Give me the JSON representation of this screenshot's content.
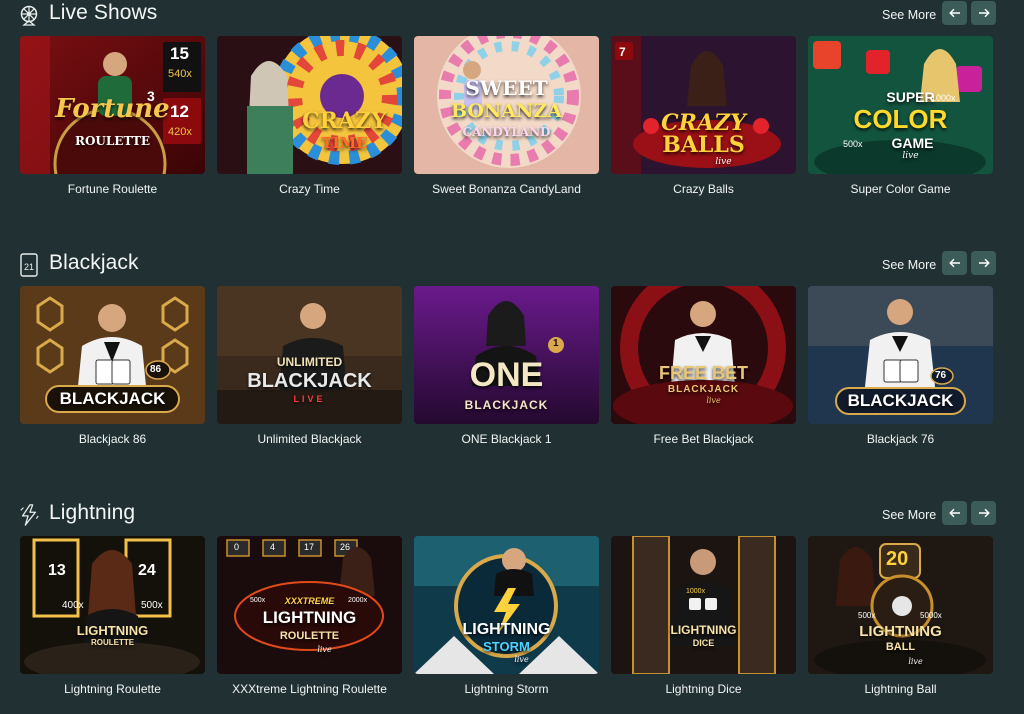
{
  "sections": [
    {
      "title": "Live Shows",
      "icon": "wheel-icon",
      "see_more": "See More",
      "cards": [
        {
          "name": "Fortune Roulette",
          "logo": [
            "Fortune",
            "ROULETTE"
          ],
          "badges": [
            "15",
            "540x",
            "12",
            "420x",
            "3"
          ]
        },
        {
          "name": "Crazy Time",
          "logo": [
            "CRAZY",
            "TIME"
          ]
        },
        {
          "name": "Sweet Bonanza CandyLand",
          "logo": [
            "SWEET",
            "BONANZA",
            "CANDYLAND"
          ]
        },
        {
          "name": "Crazy Balls",
          "logo": [
            "CRAZY",
            "BALLS",
            "live"
          ],
          "badges": [
            "7"
          ]
        },
        {
          "name": "Super Color Game",
          "logo": [
            "SUPER",
            "COLOR",
            "GAME",
            "live"
          ],
          "badges": [
            "1000x",
            "500x"
          ]
        }
      ]
    },
    {
      "title": "Blackjack",
      "icon": "card-21-icon",
      "icon_text": "21",
      "see_more": "See More",
      "cards": [
        {
          "name": "Blackjack 86",
          "logo": [
            "BLACKJACK"
          ],
          "badges": [
            "86"
          ]
        },
        {
          "name": "Unlimited Blackjack",
          "logo": [
            "UNLIMITED",
            "BLACKJACK",
            "LIVE"
          ]
        },
        {
          "name": "ONE Blackjack 1",
          "logo": [
            "ONE",
            "BLACKJACK"
          ],
          "badges": [
            "1"
          ]
        },
        {
          "name": "Free Bet Blackjack",
          "logo": [
            "FREE BET",
            "BLACKJACK",
            "live"
          ]
        },
        {
          "name": "Blackjack 76",
          "logo": [
            "BLACKJACK"
          ],
          "badges": [
            "76"
          ]
        }
      ]
    },
    {
      "title": "Lightning",
      "icon": "lightning-icon",
      "see_more": "See More",
      "cards": [
        {
          "name": "Lightning Roulette",
          "logo": [
            "LIGHTNING",
            "ROULETTE"
          ],
          "badges": [
            "13",
            "24",
            "400x",
            "500x"
          ]
        },
        {
          "name": "XXXtreme Lightning Roulette",
          "logo": [
            "XXXTREME",
            "LIGHTNING",
            "ROULETTE",
            "live"
          ],
          "badges": [
            "0",
            "4",
            "17",
            "26",
            "500x",
            "2000x"
          ]
        },
        {
          "name": "Lightning Storm",
          "logo": [
            "LIGHTNING",
            "STORM",
            "live"
          ]
        },
        {
          "name": "Lightning Dice",
          "logo": [
            "LIGHTNING",
            "DICE"
          ],
          "badges": [
            "1000x"
          ]
        },
        {
          "name": "Lightning Ball",
          "logo": [
            "LIGHTNING",
            "BALL",
            "live"
          ],
          "badges": [
            "20",
            "500x",
            "5000x"
          ]
        }
      ]
    }
  ],
  "colors": {
    "background": "#213133",
    "nav_button": "#3c5c5a",
    "text": "#ffffff"
  }
}
